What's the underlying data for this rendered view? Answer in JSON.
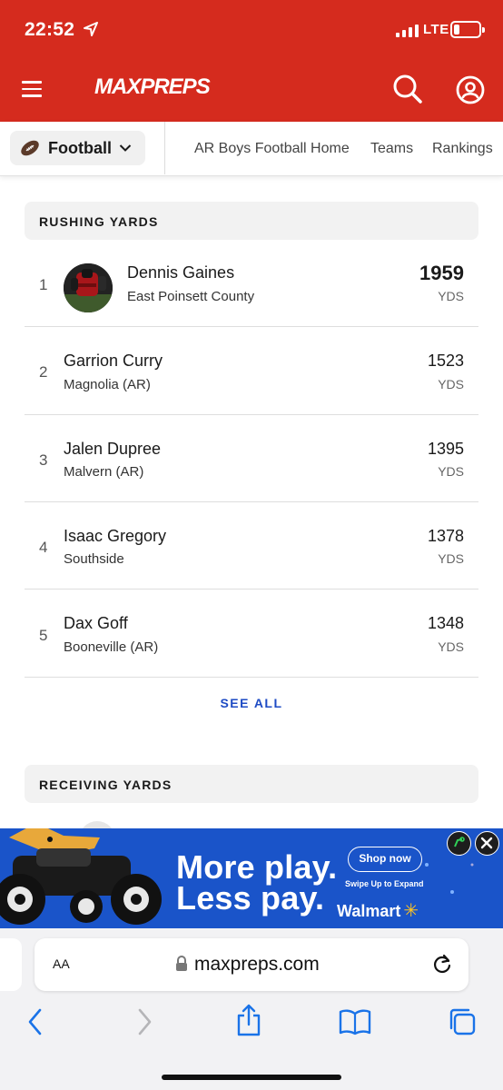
{
  "status_bar": {
    "time": "22:52",
    "network": "LTE"
  },
  "header": {
    "logo_text": "MAXPREPS"
  },
  "subnav": {
    "sport": "Football",
    "links": [
      "AR Boys Football Home",
      "Teams",
      "Rankings"
    ]
  },
  "leaderboard": {
    "title": "RUSHING YARDS",
    "rows": [
      {
        "rank": "1",
        "name": "Dennis Gaines",
        "school": "East Poinsett County",
        "value": "1959",
        "unit": "YDS"
      },
      {
        "rank": "2",
        "name": "Garrion Curry",
        "school": "Magnolia (AR)",
        "value": "1523",
        "unit": "YDS"
      },
      {
        "rank": "3",
        "name": "Jalen Dupree",
        "school": "Malvern (AR)",
        "value": "1395",
        "unit": "YDS"
      },
      {
        "rank": "4",
        "name": "Isaac Gregory",
        "school": "Southside",
        "value": "1378",
        "unit": "YDS"
      },
      {
        "rank": "5",
        "name": "Dax Goff",
        "school": "Booneville (AR)",
        "value": "1348",
        "unit": "YDS"
      }
    ],
    "see_all": "SEE ALL"
  },
  "next_section": {
    "title": "RECEIVING YARDS"
  },
  "ad": {
    "line1": "More play.",
    "line2": "Less pay.",
    "cta": "Shop now",
    "subtext": "Swipe Up to Expand",
    "brand": "Walmart"
  },
  "browser": {
    "text_size_label": "AA",
    "url": "maxpreps.com"
  },
  "colors": {
    "brand_red": "#d52b1e",
    "link_blue": "#1e4bc4",
    "ad_blue": "#1a54c9"
  }
}
